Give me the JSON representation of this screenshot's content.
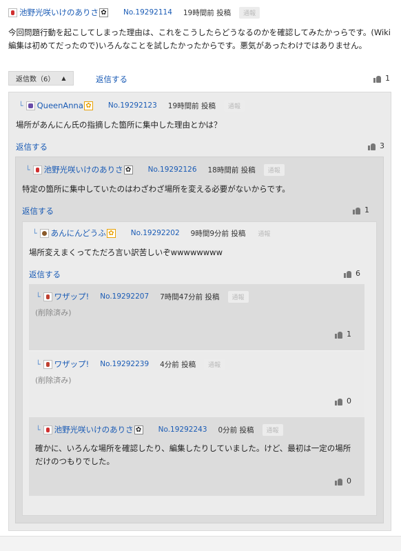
{
  "top_comment": {
    "user": "池野光咲いけのありさ",
    "star": "✿",
    "number": "No.19292114",
    "time": "19時間前 投稿",
    "report": "通報",
    "body": "今回問題行動を起こしてしまった理由は、これをこうしたらどうなるのかを確認してみたかっらです。(Wiki編集は初めてだったので)いろんなことを試したかったからです。悪気があったわけではありません。",
    "likes": "1"
  },
  "reply_controls": {
    "count_label": "返信数（6）",
    "chevron": "▲",
    "reply_link": "返信する"
  },
  "replies": [
    {
      "user": "QueenAnna",
      "star": "✿",
      "number": "No.19292123",
      "time": "19時間前 投稿",
      "report": "通報",
      "body": "場所があんにん氏の指摘した箇所に集中した理由とかは？",
      "reply_link": "返信する",
      "likes": "3"
    },
    {
      "user": "池野光咲いけのありさ",
      "star": "✿",
      "number": "No.19292126",
      "time": "18時間前 投稿",
      "report": "通報",
      "body": "特定の箇所に集中していたのはわざわざ場所を変える必要がないからです。",
      "reply_link": "返信する",
      "likes": "1"
    },
    {
      "user": "あんにんどうふ",
      "star": "✿",
      "number": "No.19292202",
      "time": "9時間9分前 投稿",
      "report": "通報",
      "body": "場所変えまくってただろ言い訳苦しいぞwwwwwwww",
      "reply_link": "返信する",
      "likes": "6"
    },
    {
      "user": "ワザップ!",
      "number": "No.19292207",
      "time": "7時間47分前 投稿",
      "report": "通報",
      "body": "(削除済み)",
      "likes": "1"
    },
    {
      "user": "ワザップ!",
      "number": "No.19292239",
      "time": "4分前 投稿",
      "report": "通報",
      "body": "(削除済み)",
      "likes": "0"
    },
    {
      "user": "池野光咲いけのありさ",
      "star": "✿",
      "number": "No.19292243",
      "time": "0分前 投稿",
      "report": "通報",
      "body": "確かに、いろんな場所を確認したり、編集したりしていました。けど、最初は一定の場所だけのつもりでした。",
      "likes": "0"
    }
  ]
}
